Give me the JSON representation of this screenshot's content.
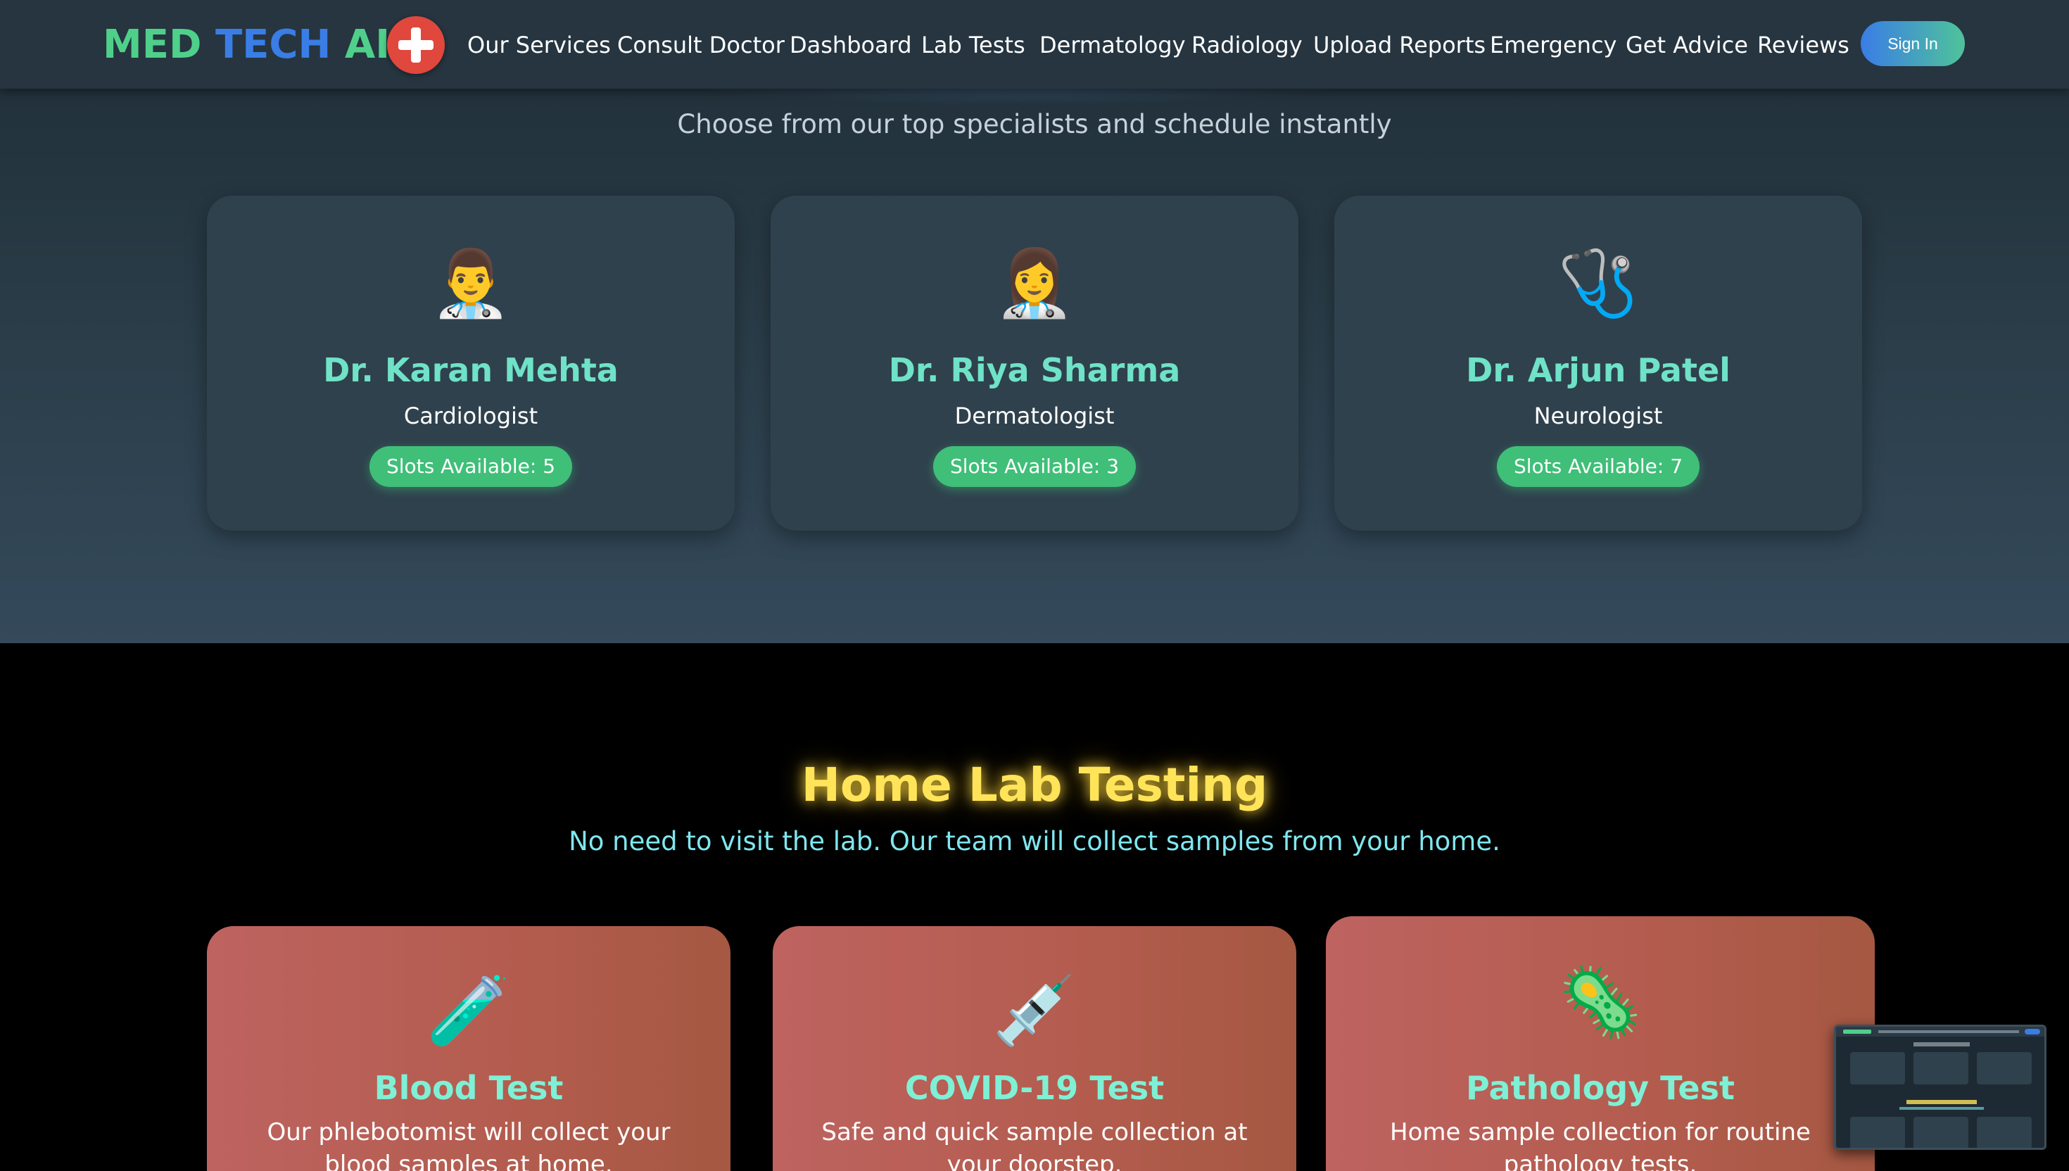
{
  "nav": {
    "brand_part1": "MED",
    "brand_part2": "TECH",
    "brand_part3": "AI",
    "logo_icon": "medical-cross-icon",
    "links": [
      "Our Services",
      "Consult Doctor",
      "Dashboard",
      "Lab Tests",
      "Dermatology",
      "Radiology",
      "Upload Reports",
      "Emergency",
      "Get Advice",
      "Reviews"
    ],
    "signin_label": "Sign In"
  },
  "appointment": {
    "subtitle": "Choose from our top specialists and schedule instantly",
    "doctors": [
      {
        "icon": "👨‍⚕️",
        "name": "Dr. Karan Mehta",
        "specialty": "Cardiologist",
        "slots": "Slots Available: 5"
      },
      {
        "icon": "👩‍⚕️",
        "name": "Dr. Riya Sharma",
        "specialty": "Dermatologist",
        "slots": "Slots Available: 3"
      },
      {
        "icon": "🩺",
        "name": "Dr. Arjun Patel",
        "specialty": "Neurologist",
        "slots": "Slots Available: 7"
      }
    ]
  },
  "lab": {
    "title": "Home Lab Testing",
    "subtitle": "No need to visit the lab. Our team will collect samples from your home.",
    "tests": [
      {
        "icon": "🧪",
        "name": "Blood Test",
        "desc": "Our phlebotomist will collect your blood samples at home."
      },
      {
        "icon": "💉",
        "name": "COVID-19 Test",
        "desc": "Safe and quick sample collection at your doorstep."
      },
      {
        "icon": "🦠",
        "name": "Pathology Test",
        "desc": "Home sample collection for routine pathology tests."
      }
    ]
  },
  "colors": {
    "brand_green": "#4fd08a",
    "brand_blue": "#3a7de6",
    "accent_teal": "#6fe2c7",
    "badge_green": "#3fbf78",
    "lab_title_yellow": "#ffe45a",
    "lab_card": "#be6360"
  }
}
